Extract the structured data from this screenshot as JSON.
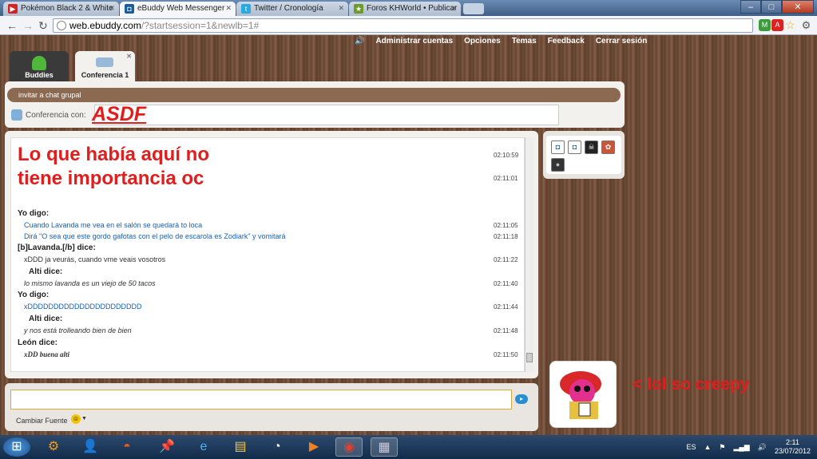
{
  "browser": {
    "tabs": [
      {
        "title": "Pokémon Black 2 & White",
        "icon_color": "#d32323",
        "active": false
      },
      {
        "title": "eBuddy Web Messenger",
        "icon_color": "#1b5c9b",
        "active": true
      },
      {
        "title": "Twitter / Cronología",
        "icon_color": "#2aa9e0",
        "active": false
      },
      {
        "title": "Foros KHWorld • Publicar",
        "icon_color": "#6c9b2a",
        "active": false
      }
    ],
    "url_host": "web.ebuddy.com",
    "url_rest": "/?startsession=1&newlb=1#",
    "window_controls": {
      "minimize": "–",
      "maximize": "□",
      "close": "✕"
    }
  },
  "topmenu": {
    "items": [
      "Administrar cuentas",
      "Opciones",
      "Temas",
      "Feedback",
      "Cerrar sesión"
    ]
  },
  "apptabs": {
    "buddies": "Buddies",
    "conference": "Conferencia 1"
  },
  "conference": {
    "invite_label": "invitar a chat grupal",
    "label": "Conferencia con:",
    "overlay_text": "ASDF"
  },
  "chat": {
    "overlay_line1": "Lo que había aquí no",
    "overlay_line2": "tiene importancia oc",
    "times_top": [
      "02:10:59",
      "02:11:01"
    ],
    "messages": [
      {
        "sender": "Yo digo:",
        "lines": [
          {
            "text": "Cuando Lavanda me vea en el salón se quedará to loca",
            "time": "02:11:05"
          },
          {
            "text": "Dirá \"O sea que este gordo gafotas con el pelo de escarola es Zodiark\" y vomitará",
            "time": "02:11:18"
          }
        ]
      },
      {
        "sender": "[b]Lavanda.[/b] dice:",
        "lines": [
          {
            "text": "xDDD ja veurás, cuando vme veais vosotros",
            "time": "02:11:22"
          }
        ]
      },
      {
        "sender": "Alti  dice:",
        "lines": [
          {
            "text": "lo mismo lavanda es un viejo de 50 tacos",
            "time": "02:11:40"
          }
        ]
      },
      {
        "sender": "Yo digo:",
        "lines": [
          {
            "text": "xDDDDDDDDDDDDDDDDDDDDDD",
            "time": "02:11:44"
          }
        ]
      },
      {
        "sender": "Alti  dice:",
        "lines": [
          {
            "text": "y nos está trolleando bien de bien",
            "time": "02:11:48"
          }
        ]
      },
      {
        "sender": "León dice:",
        "lines": [
          {
            "text": "xDD buena alti",
            "time": "02:11:50"
          }
        ]
      }
    ]
  },
  "footer": {
    "change_font": "Cambiar Fuente"
  },
  "annotation": "< lol so creepy",
  "taskbar": {
    "lang": "ES",
    "time": "2:11",
    "date": "23/07/2012"
  },
  "colors": {
    "accent_red": "#e31c1c",
    "link_blue": "#1560b8",
    "panel_brown": "#8c6a52"
  }
}
